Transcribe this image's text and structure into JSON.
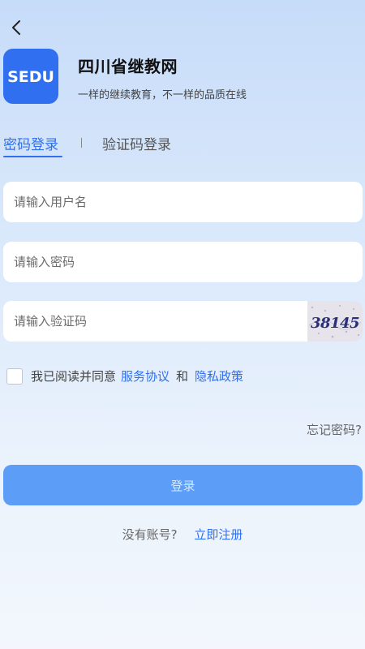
{
  "header": {
    "back_icon": "chevron-left-icon",
    "logo_text": "SEDU",
    "brand_color": "#2f6ff0",
    "title": "四川省继教网",
    "slogan": "一样的继续教育，不一样的品质在线"
  },
  "tabs": [
    {
      "label": "密码登录",
      "active": true
    },
    {
      "label": "验证码登录",
      "active": false
    }
  ],
  "form": {
    "username_placeholder": "请输入用户名",
    "password_placeholder": "请输入密码",
    "captcha_placeholder": "请输入验证码",
    "captcha_text": "38145"
  },
  "agreement": {
    "checked": false,
    "prefix": "我已阅读并同意",
    "service_link": "服务协议",
    "and_text": "和",
    "privacy_link": "隐私政策"
  },
  "forgot_password": "忘记密码?",
  "login_button": "登录",
  "register": {
    "question": "没有账号?",
    "link": "立即注册"
  }
}
